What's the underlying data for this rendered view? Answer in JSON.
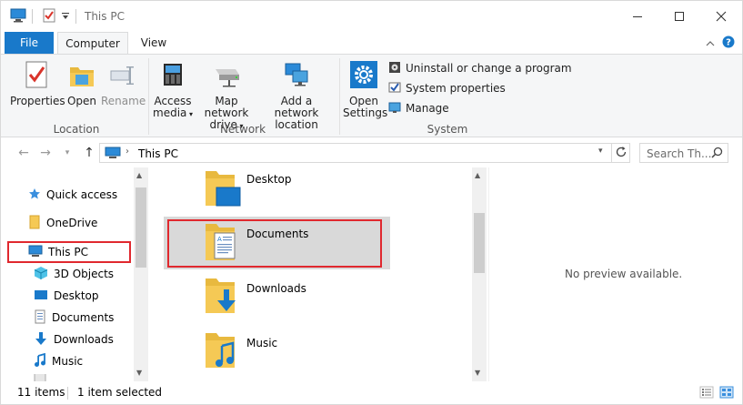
{
  "window": {
    "title": "This PC"
  },
  "tabs": {
    "file": "File",
    "computer": "Computer",
    "view": "View"
  },
  "ribbon": {
    "location": {
      "label": "Location",
      "properties": "Properties",
      "open": "Open",
      "rename": "Rename"
    },
    "network": {
      "label": "Network",
      "access_media_line1": "Access",
      "access_media_line2": "media",
      "map_drive_line1": "Map network",
      "map_drive_line2": "drive",
      "add_location_line1": "Add a network",
      "add_location_line2": "location"
    },
    "system": {
      "label": "System",
      "open_settings_line1": "Open",
      "open_settings_line2": "Settings",
      "uninstall": "Uninstall or change a program",
      "system_properties": "System properties",
      "manage": "Manage"
    }
  },
  "address": {
    "path": "This PC",
    "search_placeholder": "Search Th..."
  },
  "navpane": {
    "items": [
      {
        "label": "Quick access",
        "icon": "star-icon"
      },
      {
        "label": "OneDrive",
        "icon": "folder-icon"
      },
      {
        "label": "This PC",
        "icon": "computer-icon"
      },
      {
        "label": "3D Objects",
        "icon": "cube-icon"
      },
      {
        "label": "Desktop",
        "icon": "desktop-icon"
      },
      {
        "label": "Documents",
        "icon": "document-icon"
      },
      {
        "label": "Downloads",
        "icon": "download-icon"
      },
      {
        "label": "Music",
        "icon": "music-icon"
      }
    ]
  },
  "content": {
    "folders": [
      {
        "label": "Desktop",
        "selected": false
      },
      {
        "label": "Documents",
        "selected": true
      },
      {
        "label": "Downloads",
        "selected": false
      },
      {
        "label": "Music",
        "selected": false
      }
    ]
  },
  "preview": {
    "text": "No preview available."
  },
  "status": {
    "item_count": "11 items",
    "selection": "1 item selected"
  },
  "colors": {
    "accent": "#1979ca",
    "highlight": "#e0282e",
    "folder": "#f5c955"
  }
}
